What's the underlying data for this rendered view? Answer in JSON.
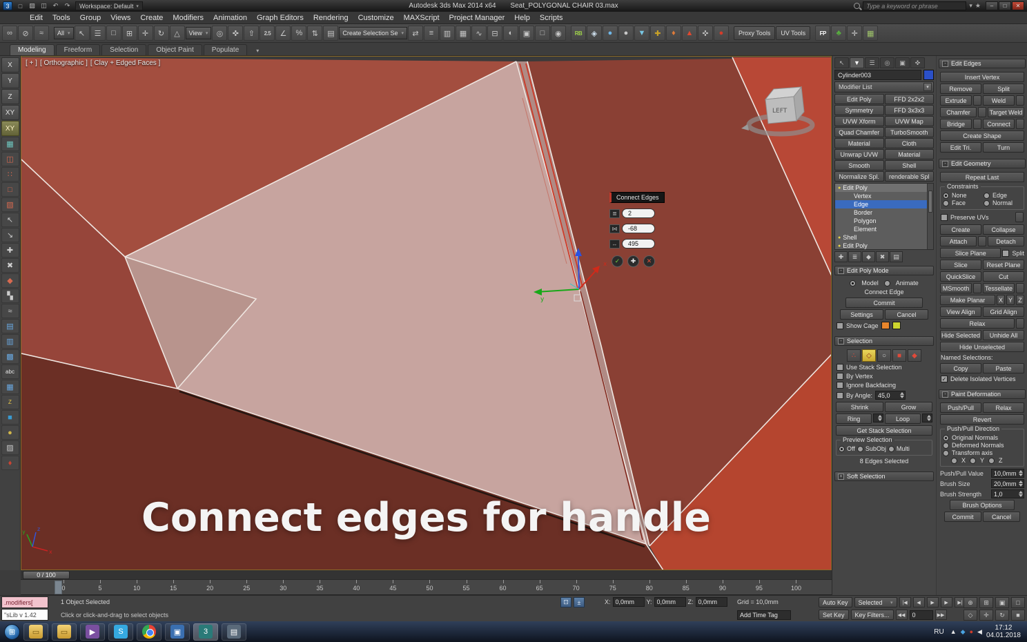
{
  "glyphs": {
    "down": "▾",
    "star": "★",
    "check": "✓",
    "plus": "✚",
    "cross": "✕"
  },
  "titlebar": {
    "app_icon": "3",
    "quick_access": [
      {
        "name": "new-scene-icon",
        "g": "□"
      },
      {
        "name": "open-file-icon",
        "g": "▨"
      },
      {
        "name": "save-file-icon",
        "g": "◫"
      },
      {
        "name": "undo-icon",
        "g": "↶"
      },
      {
        "name": "redo-icon",
        "g": "↷"
      }
    ],
    "workspace_label": "Workspace: Default",
    "app_title": "Autodesk 3ds Max 2014 x64",
    "doc_title": "Seat_POLYGONAL CHAIR 03.max",
    "search_placeholder": "Type a keyword or phrase",
    "win_min": "–",
    "win_max": "□",
    "win_close": "✕"
  },
  "menubar": [
    "Edit",
    "Tools",
    "Group",
    "Views",
    "Create",
    "Modifiers",
    "Animation",
    "Graph Editors",
    "Rendering",
    "Customize",
    "MAXScript",
    "Project Manager",
    "Help",
    "Scripts"
  ],
  "ribbon_tabs": [
    {
      "label": "Modeling",
      "cls": "active"
    },
    {
      "label": "Freeform"
    },
    {
      "label": "Selection"
    },
    {
      "label": "Object Paint"
    },
    {
      "label": "Populate"
    }
  ],
  "ribbon_arrow": "▾",
  "toolbar": {
    "icons_a": [
      {
        "name": "select-and-link-icon",
        "g": "∞"
      },
      {
        "name": "unlink-selection-icon",
        "g": "⊘"
      },
      {
        "name": "bind-to-space-warp-icon",
        "g": "≈"
      }
    ],
    "selection_filter": "All",
    "icons_b": [
      {
        "name": "select-object-icon",
        "g": "↖"
      },
      {
        "name": "select-by-name-icon",
        "g": "☰"
      },
      {
        "name": "selection-region-icon",
        "g": "□"
      },
      {
        "name": "window-crossing-icon",
        "g": "⊞"
      },
      {
        "name": "select-and-move-icon",
        "g": "✛"
      },
      {
        "name": "select-and-rotate-icon",
        "g": "↻"
      },
      {
        "name": "select-and-scale-icon",
        "g": "△"
      }
    ],
    "reference_coord": "View",
    "icons_c": [
      {
        "name": "use-pivot-center-icon",
        "g": "◎"
      },
      {
        "name": "select-and-manipulate-icon",
        "g": "✜"
      },
      {
        "name": "keyboard-override-icon",
        "g": "⇧"
      },
      {
        "name": "snaps-toggle-icon",
        "g": "2.5",
        "cls": "txt"
      },
      {
        "name": "angle-snap-icon",
        "g": "∠"
      },
      {
        "name": "percent-snap-icon",
        "g": "%"
      },
      {
        "name": "spinner-snap-icon",
        "g": "⇅"
      },
      {
        "name": "edit-selection-sets-icon",
        "g": "▤"
      }
    ],
    "selection_set_value": "Create Selection Se",
    "icons_d": [
      {
        "name": "mirror-icon",
        "g": "⇄"
      },
      {
        "name": "align-icon",
        "g": "≡"
      },
      {
        "name": "layer-manager-icon",
        "g": "▥"
      },
      {
        "name": "ribbon-toggle-icon",
        "g": "▦"
      },
      {
        "name": "curve-editor-icon",
        "g": "∿"
      },
      {
        "name": "schematic-view-icon",
        "g": "⊟"
      },
      {
        "name": "material-editor-icon",
        "g": "◐"
      },
      {
        "name": "render-setup-icon",
        "g": "▣"
      },
      {
        "name": "rendered-frame-icon",
        "g": "□"
      },
      {
        "name": "render-production-icon",
        "g": "◉"
      }
    ],
    "icons_e": [
      {
        "name": "plugin-rb-icon",
        "g": "RB",
        "c": "#9fd24a",
        "cls": "txt"
      },
      {
        "name": "plugin-diamond-icon",
        "g": "◈",
        "c": "#cfe0ee"
      },
      {
        "name": "plugin-sphere-blue-icon",
        "g": "●",
        "c": "#6fb7e8"
      },
      {
        "name": "plugin-sphere-gray-icon",
        "g": "●",
        "c": "#c8c8c8"
      },
      {
        "name": "plugin-drop-icon",
        "g": "▼",
        "c": "#79c7e3"
      },
      {
        "name": "plugin-gears-icon",
        "g": "✚",
        "c": "#c9a227"
      },
      {
        "name": "plugin-teapot-icon",
        "g": "♦",
        "c": "#e07b39"
      },
      {
        "name": "plugin-flame-icon",
        "g": "▲",
        "c": "#e0482f"
      },
      {
        "name": "plugin-wrench-icon",
        "g": "✜",
        "c": "#b8b8b8"
      },
      {
        "name": "plugin-pin-icon",
        "g": "●",
        "c": "#d43c2a"
      }
    ],
    "proxy_tools": "Proxy Tools",
    "uv_tools": "UV Tools",
    "icons_f": [
      {
        "name": "fp-icon",
        "g": "FP",
        "c": "#ffffff",
        "bg": "#e8891c",
        "cls": "txt"
      },
      {
        "name": "tree-icon",
        "g": "♣",
        "c": "#58b13e"
      },
      {
        "name": "wrench-tool-icon",
        "g": "✛",
        "c": "#cfcfcf"
      },
      {
        "name": "grid-tool-icon",
        "g": "▦",
        "c": "#9fc46a"
      }
    ]
  },
  "left_toolbar": {
    "letters": [
      {
        "label": "X"
      },
      {
        "label": "Y"
      },
      {
        "label": "Z"
      },
      {
        "label": "XY"
      },
      {
        "label": "XY",
        "cls": "active"
      }
    ],
    "icons": [
      {
        "g": "▦",
        "c": "#6fc8c0"
      },
      {
        "g": "◫",
        "c": "#d86a50"
      },
      {
        "g": "∷",
        "c": "#d86a50"
      },
      {
        "g": "□",
        "c": "#d86a50"
      },
      {
        "g": "▧",
        "c": "#d86a50"
      },
      {
        "g": "↖",
        "c": "#c8c8c8"
      },
      {
        "g": "↘",
        "c": "#c8c8c8"
      },
      {
        "g": "✚",
        "c": "#d0d0d0"
      },
      {
        "g": "✖",
        "c": "#d0d0d0"
      },
      {
        "g": "◆",
        "c": "#d86a50"
      },
      {
        "g": "▚",
        "c": "#cccccc"
      },
      {
        "g": "≈",
        "c": "#cccccc"
      },
      {
        "g": "▤",
        "c": "#6aa8e0"
      },
      {
        "g": "▥",
        "c": "#6aa8e0"
      },
      {
        "g": "▩",
        "c": "#6aa8e0"
      },
      {
        "g": "abc",
        "c": "#e8e8e8",
        "cls": "txt"
      },
      {
        "g": "▦",
        "c": "#6aa8e0"
      },
      {
        "g": "Z",
        "c": "#e8c84a",
        "cls": "txt"
      },
      {
        "g": "■",
        "c": "#3a9ad0"
      },
      {
        "g": "●",
        "c": "#d0b64a"
      },
      {
        "g": "▨",
        "c": "#c8c8c8"
      },
      {
        "g": "♦",
        "c": "#cc4433"
      }
    ]
  },
  "viewport": {
    "label_plus": "[ + ]",
    "label_pov": "[ Orthographic ]",
    "label_shading": "[ Clay + Edged Faces ]",
    "caption": "Connect edges for handle",
    "viewcube_face": "LEFT",
    "axis": {
      "x": "x",
      "y": "y",
      "z": "z"
    },
    "caddy": {
      "title": "Connect Edges",
      "rows": [
        {
          "name": "segments-value-field",
          "icon_name": "segments-icon",
          "icon": "≣",
          "value": "2"
        },
        {
          "name": "pinch-value-field",
          "icon_name": "pinch-icon",
          "icon": "⋈",
          "value": "-68"
        },
        {
          "name": "slide-value-field",
          "icon_name": "slide-icon",
          "icon": "↔",
          "value": "495"
        }
      ],
      "ok_glyph": "✓",
      "apply_glyph": "✚",
      "cancel_glyph": "✕"
    }
  },
  "scene": {
    "bg": "#3a3a3a",
    "face_light": "#c7a49f",
    "face_mid": "#a34e3f",
    "face_dark": "#8a4034",
    "face_bottom": "#6b2f25",
    "face_bright": "#b84836",
    "edge_white": "#efe6e1",
    "edge_selected": "#cc3a28"
  },
  "command_panel": {
    "tabs": [
      {
        "name": "panel-tab-create-icon",
        "g": "↖"
      },
      {
        "name": "panel-tab-modify-icon",
        "g": "▼",
        "cls": "active"
      },
      {
        "name": "panel-tab-hierarchy-icon",
        "g": "☰"
      },
      {
        "name": "panel-tab-motion-icon",
        "g": "◎"
      },
      {
        "name": "panel-tab-display-icon",
        "g": "▣"
      },
      {
        "name": "panel-tab-utilities-icon",
        "g": "✜"
      }
    ],
    "object_name": "Cylinder003",
    "object_color": "#2b50c8",
    "modifier_list_label": "Modifier List",
    "modifier_buttons": [
      "Edit Poly",
      "FFD 2x2x2",
      "Symmetry",
      "FFD 3x3x3",
      "UVW Xform",
      "UVW Map",
      "Quad Chamfer",
      "TurboSmooth",
      "Material",
      "Cloth",
      "Unwrap UVW",
      "Material",
      "Smooth",
      "Shell",
      "Normalize Spl.",
      "renderable Spl"
    ],
    "stack": [
      {
        "label": "Edit Poly",
        "cls": "cur",
        "bulb": "●"
      },
      {
        "label": "Vertex",
        "cls": "sub"
      },
      {
        "label": "Edge",
        "cls": "sub sel"
      },
      {
        "label": "Border",
        "cls": "sub"
      },
      {
        "label": "Polygon",
        "cls": "sub"
      },
      {
        "label": "Element",
        "cls": "sub"
      },
      {
        "label": "Shell",
        "bulb": "●"
      },
      {
        "label": "Edit Poly",
        "bulb": "●"
      }
    ],
    "stack_tools": [
      {
        "name": "pin-stack-icon",
        "g": "✚"
      },
      {
        "name": "show-end-result-icon",
        "g": "≣"
      },
      {
        "name": "make-unique-icon",
        "g": "◆"
      },
      {
        "name": "remove-modifier-icon",
        "g": "✖"
      },
      {
        "name": "configure-modifier-sets-icon",
        "g": "▤"
      }
    ],
    "edit_poly_mode": {
      "title": "Edit Poly Mode",
      "radio_model": "Model",
      "radio_animate": "Animate",
      "op_label": "Connect Edge",
      "commit": "Commit",
      "settings": "Settings",
      "cancel": "Cancel",
      "show_cage": "Show Cage",
      "cage_color_1": "#e8862c",
      "cage_color_2": "#cdd62f"
    },
    "selection": {
      "title": "Selection",
      "subobj": [
        {
          "name": "vertex-mode-icon",
          "g": "∴",
          "c": "#e04a3a"
        },
        {
          "name": "edge-mode-icon",
          "g": "◇",
          "c": "#8a2818",
          "cls": "active"
        },
        {
          "name": "border-mode-icon",
          "g": "○",
          "c": "#d0d0d0"
        },
        {
          "name": "polygon-mode-icon",
          "g": "■",
          "c": "#e04a3a"
        },
        {
          "name": "element-mode-icon",
          "g": "◆",
          "c": "#e04a3a"
        }
      ],
      "chk_stack": "Use Stack Selection",
      "chk_vertex": "By Vertex",
      "chk_backfacing": "Ignore Backfacing",
      "chk_angle": "By Angle:",
      "angle_value": "45,0",
      "shrink": "Shrink",
      "grow": "Grow",
      "ring": "Ring",
      "loop": "Loop",
      "get_stack": "Get Stack Selection",
      "preview_title": "Preview Selection",
      "preview_off": "Off",
      "preview_subobj": "SubObj",
      "preview_multi": "Multi",
      "status": "8 Edges Selected"
    },
    "soft_selection_title": "Soft Selection"
  },
  "edit_edges": {
    "title": "Edit Edges",
    "insert_vertex": "Insert Vertex",
    "remove": "Remove",
    "split": "Split",
    "extrude": "Extrude",
    "weld": "Weld",
    "chamfer": "Chamfer",
    "target_weld": "Target Weld",
    "bridge": "Bridge",
    "connect": "Connect",
    "create_shape": "Create Shape",
    "edit_tri": "Edit Tri.",
    "turn": "Turn"
  },
  "edit_geometry": {
    "title": "Edit Geometry",
    "repeat_last": "Repeat Last",
    "constraints_title": "Constraints",
    "c_none": "None",
    "c_edge": "Edge",
    "c_face": "Face",
    "c_normal": "Normal",
    "preserve_uvs": "Preserve UVs",
    "create": "Create",
    "collapse": "Collapse",
    "attach": "Attach",
    "detach": "Detach",
    "slice_plane": "Slice Plane",
    "split_chk": "Split",
    "slice": "Slice",
    "reset_plane": "Reset Plane",
    "quickslice": "QuickSlice",
    "cut": "Cut",
    "msmooth": "MSmooth",
    "tessellate": "Tessellate",
    "make_planar": "Make Planar",
    "x": "X",
    "y": "Y",
    "z": "Z",
    "view_align": "View Align",
    "grid_align": "Grid Align",
    "relax": "Relax",
    "hide_selected": "Hide Selected",
    "unhide_all": "Unhide All",
    "hide_unselected": "Hide Unselected",
    "named_selections": "Named Selections:",
    "copy": "Copy",
    "paste": "Paste",
    "delete_isolated": "Delete Isolated Vertices"
  },
  "paint_deformation": {
    "title": "Paint Deformation",
    "push_pull": "Push/Pull",
    "relax": "Relax",
    "revert": "Revert",
    "direction_title": "Push/Pull Direction",
    "original_normals": "Original Normals",
    "deformed_normals": "Deformed Normals",
    "transform_axis": "Transform axis",
    "x": "X",
    "y": "Y",
    "z": "Z",
    "value_label": "Push/Pull Value",
    "value": "10,0mm",
    "size_label": "Brush Size",
    "size": "20,0mm",
    "strength_label": "Brush Strength",
    "strength": "1,0",
    "brush_options": "Brush Options",
    "commit": "Commit",
    "cancel": "Cancel"
  },
  "timeline": {
    "slider_label": "0 / 100",
    "ticks": [
      "0",
      "5",
      "10",
      "15",
      "20",
      "25",
      "30",
      "35",
      "40",
      "45",
      "50",
      "55",
      "60",
      "65",
      "70",
      "75",
      "80",
      "85",
      "90",
      "95",
      "100"
    ]
  },
  "statusbar": {
    "listener_line1": ".modifiers[",
    "listener_line2": "\"sLib v 1.42",
    "selected_info": "1 Object Selected",
    "prompt": "Click or click-and-drag to select objects",
    "lock_icons": [
      {
        "name": "selection-lock-toggle-icon",
        "g": "⊡"
      },
      {
        "name": "absolute-mode-toggle-icon",
        "g": "±"
      }
    ],
    "x_label": "X:",
    "y_label": "Y:",
    "z_label": "Z:",
    "x_value": "0,0mm",
    "y_value": "0,0mm",
    "z_value": "0,0mm",
    "grid_label": "Grid = 10,0mm",
    "add_time_tag": "Add Time Tag",
    "auto_key": "Auto Key",
    "selected_dropdown": "Selected",
    "set_key": "Set Key",
    "key_filters": "Key Filters...",
    "current_frame": "0",
    "transport1": [
      {
        "name": "go-to-start-button",
        "g": "|◀"
      },
      {
        "name": "previous-frame-button",
        "g": "◀"
      },
      {
        "name": "play-button",
        "g": "▶"
      },
      {
        "name": "next-frame-button",
        "g": "▶"
      },
      {
        "name": "go-to-end-button",
        "g": "▶|"
      }
    ],
    "transport2": [
      {
        "name": "key-step-back-button",
        "g": "◀◀"
      },
      {
        "name": "key-step-forward-button",
        "g": "▶▶"
      }
    ],
    "nav1": [
      {
        "name": "zoom-icon",
        "g": "⊕"
      },
      {
        "name": "zoom-all-icon",
        "g": "⊞"
      },
      {
        "name": "zoom-extents-icon",
        "g": "▣"
      },
      {
        "name": "zoom-region-icon",
        "g": "□"
      }
    ],
    "nav2": [
      {
        "name": "field-of-view-icon",
        "g": "◇"
      },
      {
        "name": "pan-icon",
        "g": "✛"
      },
      {
        "name": "orbit-icon",
        "g": "↻"
      },
      {
        "name": "maximize-viewport-toggle-icon",
        "g": "■"
      }
    ]
  },
  "taskbar": {
    "start_glyph": "⊞",
    "apps": [
      {
        "name": "taskbar-folder-icon",
        "cls": "fold",
        "g": "▭"
      },
      {
        "name": "taskbar-explorer-icon",
        "cls": "fold",
        "g": "▭"
      },
      {
        "name": "taskbar-media-icon",
        "g": "▶",
        "bg": "#7a4fa0"
      },
      {
        "name": "taskbar-skype-icon",
        "g": "S",
        "bg": "#35a8e0"
      },
      {
        "name": "taskbar-chrome-icon",
        "cls": "chrome"
      },
      {
        "name": "taskbar-app-icon",
        "g": "▣",
        "bg": "#3a6fb0"
      },
      {
        "name": "taskbar-3dsmax-icon",
        "g": "3",
        "bg": "#2a7a78",
        "app_cls": "active"
      },
      {
        "name": "taskbar-video-icon",
        "g": "▤",
        "bg": "#5a6a7a"
      }
    ],
    "lang": "RU",
    "tray": [
      {
        "name": "tray-expand-icon",
        "g": "▲",
        "c": "#e8e8e8"
      },
      {
        "name": "tray-update-icon",
        "g": "◆",
        "c": "#4aa3e0"
      },
      {
        "name": "tray-antivirus-icon",
        "g": "●",
        "c": "#d23c2a"
      },
      {
        "name": "tray-volume-icon",
        "g": "◀",
        "c": "#e8e8e8"
      }
    ],
    "time": "17:12",
    "date": "04.01.2018"
  }
}
